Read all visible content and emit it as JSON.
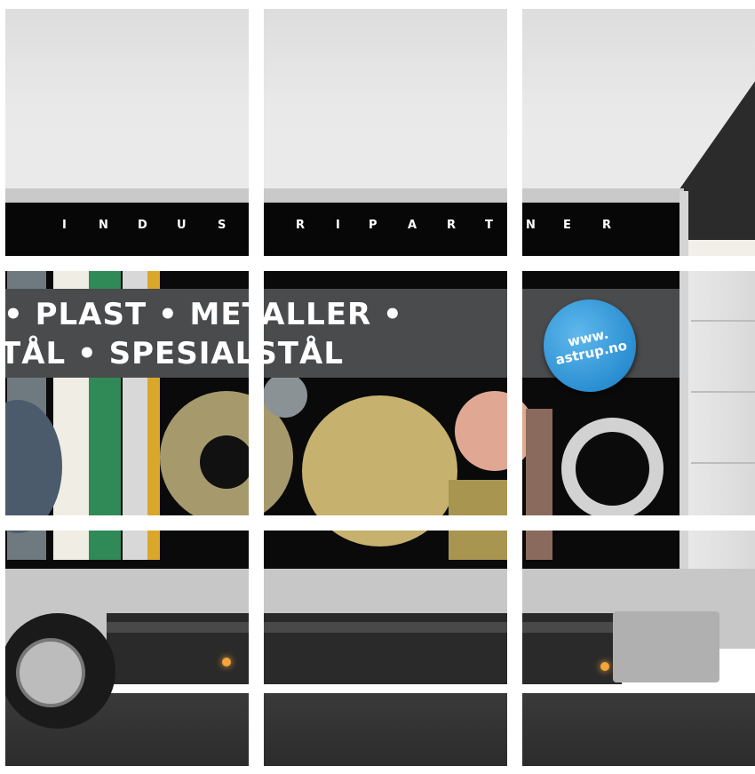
{
  "truck_stripe": {
    "letters": [
      "I",
      "N",
      "D",
      "U",
      "S",
      "R",
      "I",
      "P",
      "A",
      "R",
      "T",
      "N",
      "E",
      "R"
    ]
  },
  "banner": {
    "line1": "• PLAST • METALLER •",
    "line2": "TÅL • SPESIALSTÅL"
  },
  "badge": {
    "line1": "www.",
    "line2": "astrup.no"
  }
}
